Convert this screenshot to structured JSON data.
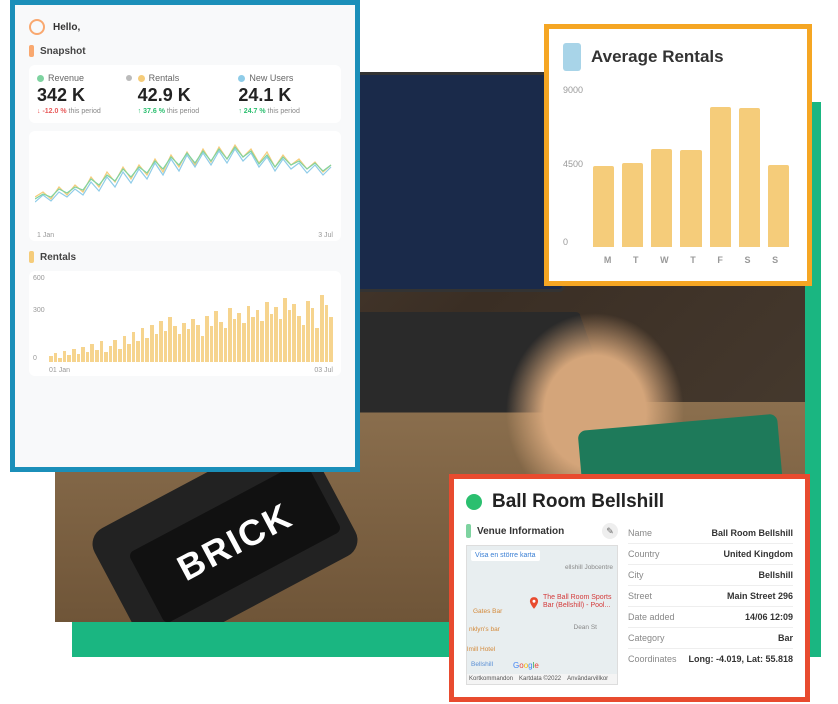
{
  "hello": "Hello,",
  "snapshot": {
    "title": "Snapshot",
    "stats": [
      {
        "label": "Revenue",
        "value": "342 K",
        "change_pct": "-12.0 %",
        "period": "this period",
        "direction": "down"
      },
      {
        "label": "Rentals",
        "value": "42.9 K",
        "change_pct": "37.6 %",
        "period": "this period",
        "direction": "up"
      },
      {
        "label": "New Users",
        "value": "24.1 K",
        "change_pct": "24.7 %",
        "period": "this period",
        "direction": "up"
      }
    ],
    "trend_x": [
      "1 Jan",
      "3 Jul"
    ]
  },
  "rentals_timeline": {
    "title": "Rentals",
    "y_ticks": [
      "600",
      "300",
      "0"
    ],
    "x_ticks": [
      "01 Jan",
      "03 Jul"
    ]
  },
  "chart_data": {
    "type": "bar",
    "title": "Average Rentals",
    "categories": [
      "M",
      "T",
      "W",
      "T",
      "F",
      "S",
      "S"
    ],
    "values": [
      4600,
      4800,
      5600,
      5500,
      8000,
      7900,
      4700
    ],
    "ylabel": "",
    "xlabel": "",
    "y_ticks": [
      0,
      4500,
      9000
    ],
    "ylim": [
      0,
      9000
    ]
  },
  "venue": {
    "title": "Ball Room Bellshill",
    "info_title": "Venue Information",
    "map": {
      "link_text": "Visa en större karta",
      "pin_label": "The Ball Room Sports Bar (Bellshill) - Pool...",
      "places": [
        "ellshill Jobcentre",
        "Gates Bar",
        "nklyn's bar",
        "lmill Hotel",
        "Bellshill",
        "Dean St"
      ],
      "footer": [
        "Kortkommandon",
        "Kartdata ©2022",
        "Användarvillkor"
      ],
      "google": "Google"
    },
    "fields": [
      {
        "label": "Name",
        "value": "Ball Room Bellshill"
      },
      {
        "label": "Country",
        "value": "United Kingdom"
      },
      {
        "label": "City",
        "value": "Bellshill"
      },
      {
        "label": "Street",
        "value": "Main Street 296"
      },
      {
        "label": "Date added",
        "value": "14/06 12:09"
      },
      {
        "label": "Category",
        "value": "Bar"
      },
      {
        "label": "Coordinates",
        "value": "Long: -4.019, Lat: 55.818"
      }
    ]
  },
  "brick": "BRICK"
}
